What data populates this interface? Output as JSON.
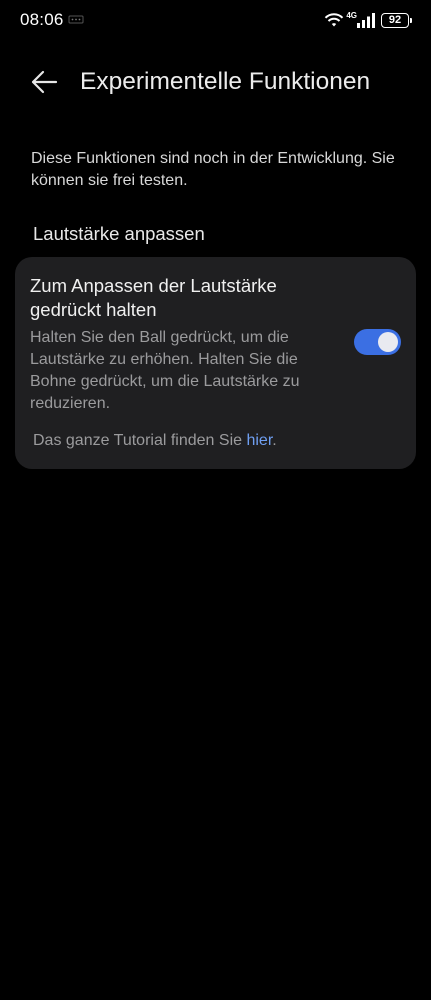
{
  "status_bar": {
    "time": "08:06",
    "network": "4G",
    "battery": "92"
  },
  "header": {
    "title": "Experimentelle Funktionen"
  },
  "description": "Diese Funktionen sind noch in der Entwicklung. Sie können sie frei testen.",
  "section": {
    "title": "Lautstärke anpassen"
  },
  "card": {
    "title": "Zum Anpassen der Lautstärke gedrückt halten",
    "description": "Halten Sie den Ball gedrückt, um die Lautstärke zu erhöhen. Halten Sie die Bohne gedrückt, um die Lautstärke zu reduzieren.",
    "toggle_on": true,
    "footer_text": "Das ganze Tutorial finden Sie ",
    "footer_link": "hier",
    "footer_end": "."
  },
  "colors": {
    "background": "#000000",
    "card": "#1f1f21",
    "accent": "#3b6fe3",
    "link": "#6f9ff2"
  },
  "icons": {
    "back": "arrow-left-icon",
    "wifi": "wifi-icon",
    "signal": "signal-icon",
    "battery": "battery-icon"
  }
}
